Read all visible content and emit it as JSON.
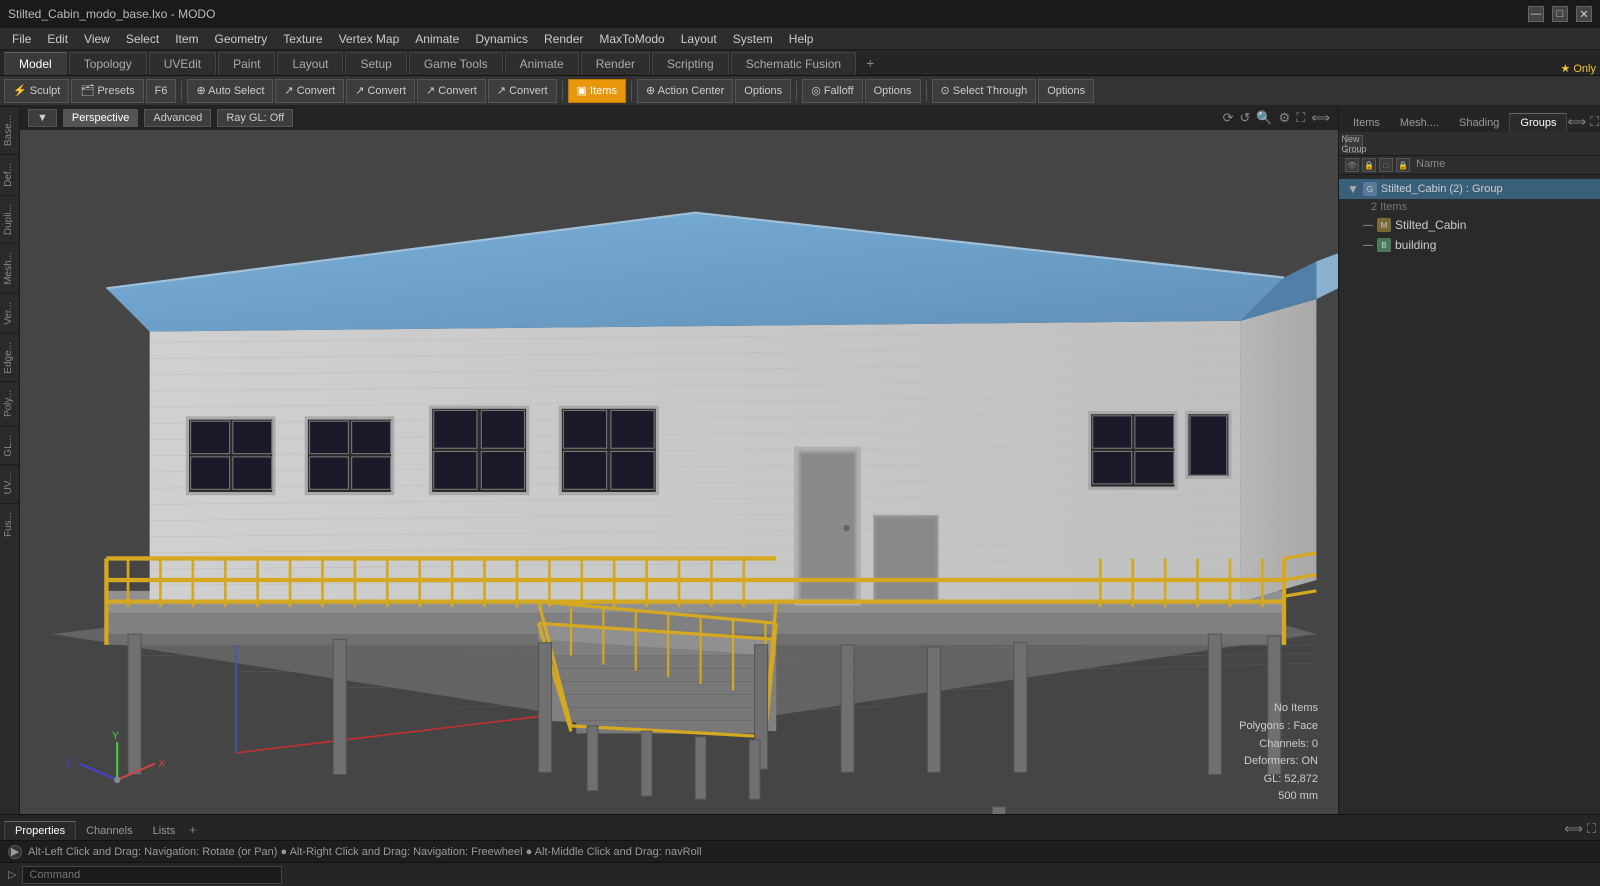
{
  "window": {
    "title": "Stilted_Cabin_modo_base.lxo - MODO"
  },
  "titleControls": {
    "minimize": "—",
    "maximize": "□",
    "close": "✕"
  },
  "menuBar": {
    "items": [
      "File",
      "Edit",
      "View",
      "Select",
      "Item",
      "Geometry",
      "Texture",
      "Vertex Map",
      "Animate",
      "Dynamics",
      "Render",
      "MaxToModo",
      "Layout",
      "System",
      "Help"
    ]
  },
  "modeTabs": {
    "tabs": [
      "Model",
      "Topology",
      "UVEdit",
      "Paint",
      "Layout",
      "Setup",
      "Game Tools",
      "Animate",
      "Render",
      "Scripting",
      "Schematic Fusion"
    ],
    "active": "Model",
    "plus": "+",
    "starLabel": "★ Only"
  },
  "toolbar": {
    "sculpt": "Sculpt",
    "presets": "Presets",
    "f6": "F6",
    "autoSelect": "Auto Select",
    "convert1": "Convert",
    "convert2": "Convert",
    "convert3": "Convert",
    "convert4": "Convert",
    "items": "Items",
    "actionCenter": "Action Center",
    "options1": "Options",
    "falloff": "Falloff",
    "options2": "Options",
    "selectThrough": "Select Through",
    "options3": "Options"
  },
  "leftTabs": [
    "Base...",
    "Def...",
    "Dupli...",
    "Mesh...",
    "Ver...",
    "Edge...",
    "Poly...",
    "GL...",
    "UV...",
    "Fus..."
  ],
  "viewport": {
    "perspective": "Perspective",
    "advanced": "Advanced",
    "rayGL": "Ray GL: Off"
  },
  "statusOverlay": {
    "noItems": "No Items",
    "polygons": "Polygons : Face",
    "channels": "Channels: 0",
    "deformers": "Deformers: ON",
    "gl": "GL: 52,872",
    "size": "500 mm"
  },
  "rightPanel": {
    "tabs": [
      "Items",
      "Mesh....",
      "Shading",
      "Groups"
    ],
    "activeTab": "Groups",
    "toolbar": [
      "eye",
      "lock",
      "square",
      "lock2"
    ],
    "colHeader": "Name",
    "tree": {
      "group": {
        "name": "Stilted_Cabin (2) : Group",
        "subText": "2 Items",
        "children": [
          {
            "name": "Stilted_Cabin",
            "type": "mesh"
          },
          {
            "name": "building",
            "type": "building"
          }
        ]
      }
    },
    "newGroup": "New Group"
  },
  "bottomTabs": {
    "tabs": [
      "Properties",
      "Channels",
      "Lists"
    ],
    "plus": "+",
    "activeTab": "Properties"
  },
  "statusBar": {
    "text": "Alt-Left Click and Drag: Navigation: Rotate (or Pan) ● Alt-Right Click and Drag: Navigation: Freewheel ● Alt-Middle Click and Drag: navRoll"
  },
  "commandBar": {
    "label": "Command",
    "placeholder": "Command"
  }
}
